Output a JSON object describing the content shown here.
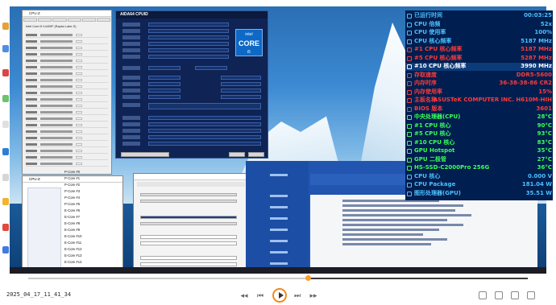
{
  "cpuz": {
    "title": "CPU-Z",
    "processor": "Intel Core i5 14400F (Raptor Lake-S)"
  },
  "aida": {
    "title": "AIDA64 CPUID",
    "logo_text": "intel",
    "logo_core": "CORE",
    "logo_sub": "i5"
  },
  "tasklist": {
    "title": "CPU-Z",
    "rows": [
      "P-Core #0",
      "P-Core #1",
      "P-Core #2",
      "P-Core #3",
      "P-Core #4",
      "P-Core #5",
      "E-Core #6",
      "E-Core #7",
      "E-Core #8",
      "E-Core #9",
      "E-Core #10",
      "E-Core #11",
      "E-Core #12",
      "E-Core #13",
      "E-Core #14",
      "E-Core #15"
    ]
  },
  "overlay": {
    "rows": [
      {
        "label": "已运行时间",
        "value": "00:03:25",
        "color": "#4ec0ff"
      },
      {
        "label": "CPU 倍频",
        "value": "52x",
        "color": "#4ec0ff"
      },
      {
        "label": "CPU 使用率",
        "value": "100%",
        "color": "#4ec0ff"
      },
      {
        "label": "CPU 核心频率",
        "value": "5187 MHz",
        "color": "#4ec0ff"
      },
      {
        "label": "#1 CPU 核心频率",
        "value": "5187 MHz",
        "color": "#ff3a3a"
      },
      {
        "label": "#5 CPU 核心频率",
        "value": "5287 MHz",
        "color": "#ff3a3a"
      },
      {
        "label": "#10 CPU 核心频率",
        "value": "3990 MHz",
        "color": "#ffffff"
      },
      {
        "label": "存取速度",
        "value": "DDR5-5600",
        "color": "#ff3a3a"
      },
      {
        "label": "内存时序",
        "value": "36-38-38-86 CR2",
        "color": "#ff3a3a"
      },
      {
        "label": "内存使用率",
        "value": "15%",
        "color": "#ff3a3a"
      },
      {
        "label": "主板名称",
        "value": "ASUSTeK COMPUTER INC. H610M-HIH",
        "color": "#ff3a3a"
      },
      {
        "label": "BIOS 版本",
        "value": "3601",
        "color": "#ff3a3a"
      },
      {
        "label": "中央处理器(CPU)",
        "value": "28°C",
        "color": "#3cff5a"
      },
      {
        "label": "#1 CPU 核心",
        "value": "90°C",
        "color": "#3cff5a"
      },
      {
        "label": "#5 CPU 核心",
        "value": "93°C",
        "color": "#3cff5a"
      },
      {
        "label": "#10 CPU 核心",
        "value": "83°C",
        "color": "#3cff5a"
      },
      {
        "label": "GPU Hotspot",
        "value": "35°C",
        "color": "#3cff5a"
      },
      {
        "label": "GPU 二极管",
        "value": "27°C",
        "color": "#3cff5a"
      },
      {
        "label": "HS-SSD-C2000Pro 256G",
        "value": "36°C",
        "color": "#3cff5a"
      },
      {
        "label": "CPU 核心",
        "value": "0.000 V",
        "color": "#4ec0ff"
      },
      {
        "label": "CPU Package",
        "value": "181.04 W",
        "color": "#4ec0ff"
      },
      {
        "label": "图形处理器(GPU)",
        "value": "35.51 W",
        "color": "#4ec0ff"
      }
    ]
  },
  "player": {
    "timestamp": "2025_04_17_11_41_34",
    "progress_fraction": 0.56
  }
}
